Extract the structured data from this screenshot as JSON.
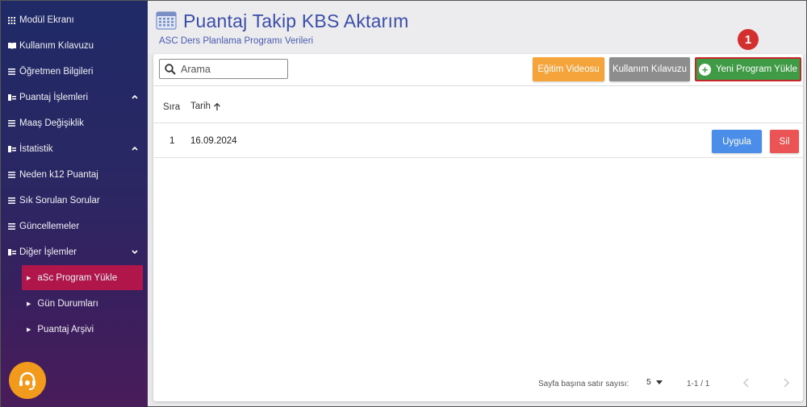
{
  "sidebar": {
    "items": [
      {
        "label": "Modül Ekranı",
        "icon": "grid-icon"
      },
      {
        "label": "Kullanım Kılavuzu",
        "icon": "book-icon"
      },
      {
        "label": "Öğretmen Bilgileri",
        "icon": "list-icon"
      },
      {
        "label": "Puantaj İşlemleri",
        "icon": "folder-icon",
        "expanded": true
      },
      {
        "label": "Maaş Değişiklik",
        "icon": "list-icon"
      },
      {
        "label": "İstatistik",
        "icon": "folder-icon",
        "expanded": true
      },
      {
        "label": "Neden k12 Puantaj",
        "icon": "list-icon"
      },
      {
        "label": "Sık Sorulan Sorular",
        "icon": "list-icon"
      },
      {
        "label": "Güncellemeler",
        "icon": "list-icon"
      },
      {
        "label": "Diğer İşlemler",
        "icon": "folder-icon",
        "expanded": false
      }
    ],
    "subitems": [
      {
        "label": "aSc Program Yükle",
        "active": true
      },
      {
        "label": "Gün Durumları",
        "active": false
      },
      {
        "label": "Puantaj Arşivi",
        "active": false
      }
    ]
  },
  "header": {
    "title": "Puantaj Takip KBS Aktarım",
    "subtitle": "ASC Ders Planlama Programı Verileri"
  },
  "toolbar": {
    "search_placeholder": "Arama",
    "video_label": "Eğitim Videosu",
    "guide_label": "Kullanım Kılavuzu",
    "upload_label": "Yeni Program Yükle",
    "marker": "1"
  },
  "table": {
    "columns": [
      "Sıra",
      "Tarih"
    ],
    "rows": [
      {
        "sira": "1",
        "tarih": "16.09.2024",
        "apply_label": "Uygula",
        "delete_label": "Sil"
      }
    ]
  },
  "pagination": {
    "rows_per_page_label": "Sayfa başına satır sayısı:",
    "rows_per_page": "5",
    "range": "1-1 / 1"
  },
  "colors": {
    "sidebar_top": "#1f2a66",
    "active_item": "#b0164a",
    "title": "#3c4fa8",
    "video_btn": "#f5a43c",
    "guide_btn": "#8d8d8d",
    "upload_btn": "#3f9b45",
    "apply_btn": "#4a8eea",
    "delete_btn": "#ea5454",
    "highlight": "#c62828"
  }
}
